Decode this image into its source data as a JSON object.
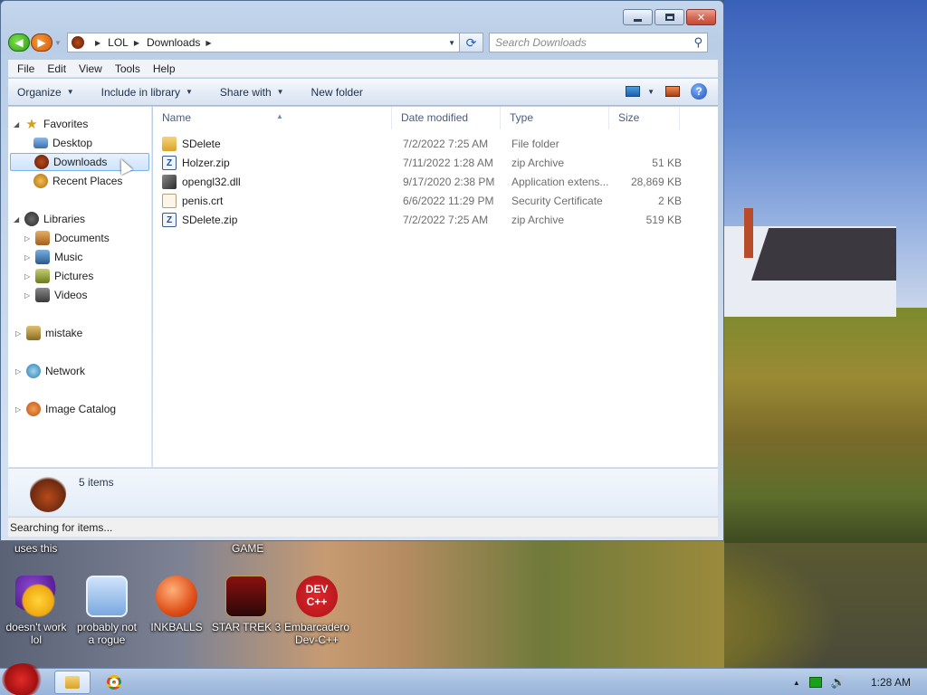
{
  "address": {
    "crumbs": [
      "LOL",
      "Downloads"
    ]
  },
  "search": {
    "placeholder": "Search Downloads"
  },
  "menu": [
    "File",
    "Edit",
    "View",
    "Tools",
    "Help"
  ],
  "toolbar": {
    "organize": "Organize",
    "include_in_library": "Include in library",
    "share_with": "Share with",
    "new_folder": "New folder"
  },
  "nav": {
    "favorites": "Favorites",
    "desktop": "Desktop",
    "downloads": "Downloads",
    "recent_places": "Recent Places",
    "libraries": "Libraries",
    "documents": "Documents",
    "music": "Music",
    "pictures": "Pictures",
    "videos": "Videos",
    "mistake": "mistake",
    "network": "Network",
    "image_catalog": "Image Catalog"
  },
  "columns": {
    "name": "Name",
    "date_modified": "Date modified",
    "type": "Type",
    "size": "Size"
  },
  "files": [
    {
      "name": "SDelete",
      "date": "7/2/2022 7:25 AM",
      "type": "File folder",
      "size": "",
      "icon": "folder-icon"
    },
    {
      "name": "Holzer.zip",
      "date": "7/11/2022 1:28 AM",
      "type": "zip Archive",
      "size": "51 KB",
      "icon": "zip-icon"
    },
    {
      "name": "opengl32.dll",
      "date": "9/17/2020 2:38 PM",
      "type": "Application extens...",
      "size": "28,869 KB",
      "icon": "dll-icon"
    },
    {
      "name": "penis.crt",
      "date": "6/6/2022 11:29 PM",
      "type": "Security Certificate",
      "size": "2 KB",
      "icon": "certificate-icon"
    },
    {
      "name": "SDelete.zip",
      "date": "7/2/2022 7:25 AM",
      "type": "zip Archive",
      "size": "519 KB",
      "icon": "zip-icon"
    }
  ],
  "details": {
    "count": "5 items"
  },
  "status": {
    "text": "Searching for items..."
  },
  "desktop_icons": {
    "partial_left": "uses this",
    "partial_game": "GAME",
    "yahoo": [
      "doesn't work",
      "lol"
    ],
    "rogue": [
      "probably not",
      "a rogue"
    ],
    "inkballs": "INKBALLS",
    "startrek": "STAR TREK 3",
    "devcpp": [
      "Embarcadero",
      "Dev-C++"
    ],
    "devcpp_logo": [
      "DEV",
      "C++"
    ]
  },
  "taskbar": {
    "clock": "1:28 AM"
  },
  "colors": {
    "accent": "#1f5fbf",
    "selection": "#cfe4fb",
    "close_red": "#c24a36"
  }
}
